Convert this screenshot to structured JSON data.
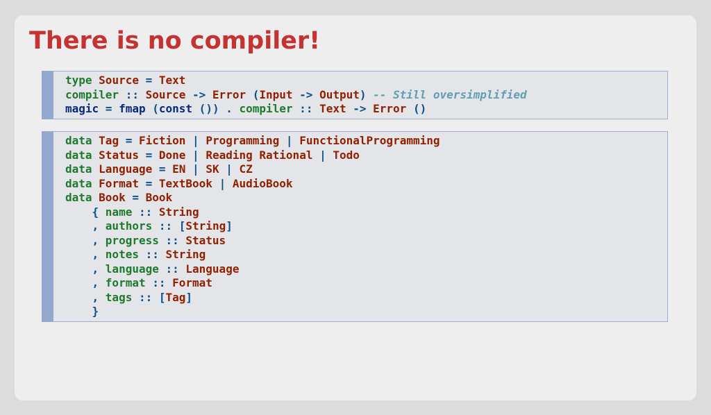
{
  "slide": {
    "title": "There is no compiler!"
  },
  "colors": {
    "title": "#c33332",
    "keyword": "#1e7a2c",
    "type": "#902000",
    "operator": "#0b4f8a",
    "function": "#06287e",
    "comment": "#5f9fb0",
    "code_bg": "#e3e5e8",
    "code_bar": "#93a8cf"
  },
  "code_blocks": [
    {
      "language": "haskell",
      "lines": [
        [
          {
            "t": "type",
            "c": "kw"
          },
          {
            "t": " ",
            "c": "pl"
          },
          {
            "t": "Source",
            "c": "ty"
          },
          {
            "t": " = ",
            "c": "op"
          },
          {
            "t": "Text",
            "c": "ty"
          }
        ],
        [
          {
            "t": "compiler",
            "c": "kw"
          },
          {
            "t": " :: ",
            "c": "op"
          },
          {
            "t": "Source",
            "c": "ty"
          },
          {
            "t": " -> ",
            "c": "op"
          },
          {
            "t": "Error",
            "c": "ty"
          },
          {
            "t": " (",
            "c": "op"
          },
          {
            "t": "Input",
            "c": "ty"
          },
          {
            "t": " -> ",
            "c": "op"
          },
          {
            "t": "Output",
            "c": "ty"
          },
          {
            "t": ") ",
            "c": "op"
          },
          {
            "t": "-- Still oversimplified",
            "c": "cm"
          }
        ],
        [
          {
            "t": "magic",
            "c": "fn"
          },
          {
            "t": " = ",
            "c": "op"
          },
          {
            "t": "fmap",
            "c": "fn"
          },
          {
            "t": " (",
            "c": "op"
          },
          {
            "t": "const",
            "c": "fn"
          },
          {
            "t": " ()) . ",
            "c": "op"
          },
          {
            "t": "compiler",
            "c": "kw"
          },
          {
            "t": " :: ",
            "c": "op"
          },
          {
            "t": "Text",
            "c": "ty"
          },
          {
            "t": " -> ",
            "c": "op"
          },
          {
            "t": "Error",
            "c": "ty"
          },
          {
            "t": " ()",
            "c": "op"
          }
        ]
      ]
    },
    {
      "language": "haskell",
      "lines": [
        [
          {
            "t": "data",
            "c": "kw"
          },
          {
            "t": " ",
            "c": "pl"
          },
          {
            "t": "Tag",
            "c": "ty"
          },
          {
            "t": " = ",
            "c": "op"
          },
          {
            "t": "Fiction",
            "c": "ty"
          },
          {
            "t": " | ",
            "c": "op"
          },
          {
            "t": "Programming",
            "c": "ty"
          },
          {
            "t": " | ",
            "c": "op"
          },
          {
            "t": "FunctionalProgramming",
            "c": "ty"
          }
        ],
        [
          {
            "t": "data",
            "c": "kw"
          },
          {
            "t": " ",
            "c": "pl"
          },
          {
            "t": "Status",
            "c": "ty"
          },
          {
            "t": " = ",
            "c": "op"
          },
          {
            "t": "Done",
            "c": "ty"
          },
          {
            "t": " | ",
            "c": "op"
          },
          {
            "t": "Reading",
            "c": "ty"
          },
          {
            "t": " ",
            "c": "pl"
          },
          {
            "t": "Rational",
            "c": "ty"
          },
          {
            "t": " | ",
            "c": "op"
          },
          {
            "t": "Todo",
            "c": "ty"
          }
        ],
        [
          {
            "t": "data",
            "c": "kw"
          },
          {
            "t": " ",
            "c": "pl"
          },
          {
            "t": "Language",
            "c": "ty"
          },
          {
            "t": " = ",
            "c": "op"
          },
          {
            "t": "EN",
            "c": "ty"
          },
          {
            "t": " | ",
            "c": "op"
          },
          {
            "t": "SK",
            "c": "ty"
          },
          {
            "t": " | ",
            "c": "op"
          },
          {
            "t": "CZ",
            "c": "ty"
          }
        ],
        [
          {
            "t": "data",
            "c": "kw"
          },
          {
            "t": " ",
            "c": "pl"
          },
          {
            "t": "Format",
            "c": "ty"
          },
          {
            "t": " = ",
            "c": "op"
          },
          {
            "t": "TextBook",
            "c": "ty"
          },
          {
            "t": " | ",
            "c": "op"
          },
          {
            "t": "AudioBook",
            "c": "ty"
          }
        ],
        [
          {
            "t": "data",
            "c": "kw"
          },
          {
            "t": " ",
            "c": "pl"
          },
          {
            "t": "Book",
            "c": "ty"
          },
          {
            "t": " = ",
            "c": "op"
          },
          {
            "t": "Book",
            "c": "ty"
          }
        ],
        [
          {
            "t": "    { ",
            "c": "op"
          },
          {
            "t": "name",
            "c": "kw"
          },
          {
            "t": " :: ",
            "c": "op"
          },
          {
            "t": "String",
            "c": "ty"
          }
        ],
        [
          {
            "t": "    , ",
            "c": "op"
          },
          {
            "t": "authors",
            "c": "kw"
          },
          {
            "t": " :: [",
            "c": "op"
          },
          {
            "t": "String",
            "c": "ty"
          },
          {
            "t": "]",
            "c": "op"
          }
        ],
        [
          {
            "t": "    , ",
            "c": "op"
          },
          {
            "t": "progress",
            "c": "kw"
          },
          {
            "t": " :: ",
            "c": "op"
          },
          {
            "t": "Status",
            "c": "ty"
          }
        ],
        [
          {
            "t": "    , ",
            "c": "op"
          },
          {
            "t": "notes",
            "c": "kw"
          },
          {
            "t": " :: ",
            "c": "op"
          },
          {
            "t": "String",
            "c": "ty"
          }
        ],
        [
          {
            "t": "    , ",
            "c": "op"
          },
          {
            "t": "language",
            "c": "kw"
          },
          {
            "t": " :: ",
            "c": "op"
          },
          {
            "t": "Language",
            "c": "ty"
          }
        ],
        [
          {
            "t": "    , ",
            "c": "op"
          },
          {
            "t": "format",
            "c": "kw"
          },
          {
            "t": " :: ",
            "c": "op"
          },
          {
            "t": "Format",
            "c": "ty"
          }
        ],
        [
          {
            "t": "    , ",
            "c": "op"
          },
          {
            "t": "tags",
            "c": "kw"
          },
          {
            "t": " :: [",
            "c": "op"
          },
          {
            "t": "Tag",
            "c": "ty"
          },
          {
            "t": "]",
            "c": "op"
          }
        ],
        [
          {
            "t": "    }",
            "c": "op"
          }
        ]
      ]
    }
  ]
}
